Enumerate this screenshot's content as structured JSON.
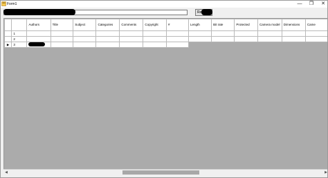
{
  "window": {
    "title": "Form1",
    "min_glyph": "—",
    "max_glyph": "❐",
    "close_glyph": "✕",
    "app_icon": "winforms-form-icon"
  },
  "toolbar": {
    "path_value": "",
    "read_label": "Read"
  },
  "grid": {
    "columns": [
      "Authors",
      "Title",
      "Subject",
      "Categories",
      "Comments",
      "Copyright",
      "#",
      "Length",
      "Bit rate",
      "Protected",
      "Camera model",
      "Dimensions",
      "Came"
    ],
    "rows": [
      {
        "header": "",
        "num": "1",
        "cells": [
          "",
          "",
          "",
          "",
          "",
          "",
          "",
          "",
          "",
          "",
          "",
          "",
          ""
        ]
      },
      {
        "header": "",
        "num": "2",
        "cells": [
          "",
          "",
          "",
          "",
          "",
          "",
          "",
          "",
          "",
          "",
          "",
          "",
          ""
        ]
      },
      {
        "header": "▶",
        "num": "3",
        "cells": [
          "",
          "",
          "",
          "",
          "",
          "",
          ""
        ]
      }
    ]
  },
  "scrollbar": {
    "left_arrow": "◀",
    "right_arrow": "▶",
    "position_fraction": 0.37
  }
}
